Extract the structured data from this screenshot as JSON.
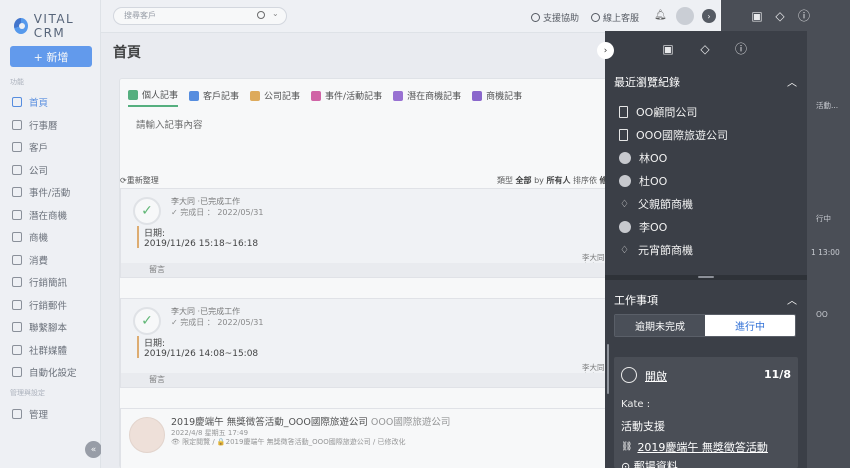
{
  "app": {
    "name": "VITAL CRM"
  },
  "sidebar": {
    "new_label": "+ 新增",
    "section_features": "功能",
    "section_admin": "管理與設定",
    "items": [
      {
        "label": "首頁"
      },
      {
        "label": "行事曆"
      },
      {
        "label": "客戶"
      },
      {
        "label": "公司"
      },
      {
        "label": "事件/活動"
      },
      {
        "label": "潛在商機"
      },
      {
        "label": "商機"
      },
      {
        "label": "消費"
      },
      {
        "label": "行銷簡訊"
      },
      {
        "label": "行銷郵件"
      },
      {
        "label": "聯繫腳本"
      },
      {
        "label": "社群媒體"
      },
      {
        "label": "自動化設定"
      },
      {
        "label": "管理"
      }
    ]
  },
  "topbar": {
    "search_placeholder": "搜尋客戶",
    "help": "支援協助",
    "service": "線上客服"
  },
  "main": {
    "title": "首頁",
    "tabs": [
      {
        "label": "個人記事",
        "color": "#3aa66b"
      },
      {
        "label": "客戶記事",
        "color": "#3b7de0"
      },
      {
        "label": "公司記事",
        "color": "#e0a040"
      },
      {
        "label": "事件/活動記事",
        "color": "#d04a9a"
      },
      {
        "label": "潛在商機記事",
        "color": "#8b5bd0"
      },
      {
        "label": "商機記事",
        "color": "#7b4fc8"
      }
    ],
    "note_placeholder": "請輸入記事內容",
    "refresh": "重新整理",
    "filter_type_label": "類型",
    "filter_type_value": "全部",
    "filter_by_label": "by",
    "filter_by_value": "所有人",
    "filter_sort_label": "排序依",
    "filter_sort_value": "修",
    "logs": [
      {
        "who": "李大同",
        "action": "·已完成工作",
        "status": "✓ 完成日 ： 2022/05/31",
        "date_label": "日期:",
        "date_value": "2019/11/26 15:18~16:18",
        "by": "李大同",
        "comment": "留言"
      },
      {
        "who": "李大同",
        "action": "·已完成工作",
        "status": "✓ 完成日 ： 2022/05/31",
        "date_label": "日期:",
        "date_value": "2019/11/26 14:08~15:08",
        "by": "李大同",
        "comment": "留言"
      }
    ],
    "event": {
      "title": "2019慶端午 無獎徵答活動_OOO國際旅遊公司",
      "company": "OOO國際旅遊公司",
      "meta1": "2022/4/8 星期五 17:49",
      "meta2": "👁 限定閱覽 / 🔒2019慶端午 無獎徵答活動_OOO國際旅遊公司 / 已修改化"
    }
  },
  "panel": {
    "recent_title": "最近瀏覽紀錄",
    "recent": [
      {
        "label": "OO顧問公司",
        "kind": "building"
      },
      {
        "label": "OOO國際旅遊公司",
        "kind": "building"
      },
      {
        "label": "林OO",
        "kind": "avatar"
      },
      {
        "label": "杜OO",
        "kind": "avatar"
      },
      {
        "label": "父親節商機",
        "kind": "bulb"
      },
      {
        "label": "李OO",
        "kind": "avatar"
      },
      {
        "label": "元宵節商機",
        "kind": "bulb"
      }
    ],
    "todo_title": "工作事項",
    "seg_overdue": "逾期未完成",
    "seg_progress": "進行中",
    "todo": {
      "status": "開啟",
      "date": "11/8",
      "assignee": "Kate :",
      "type": "活動支援",
      "link": "2019慶端午 無獎徵答活動",
      "next": "郵場資料"
    }
  },
  "background": {
    "r1": "活動...",
    "r2": "行中",
    "r3": "1 13:00",
    "r4": "OO"
  }
}
